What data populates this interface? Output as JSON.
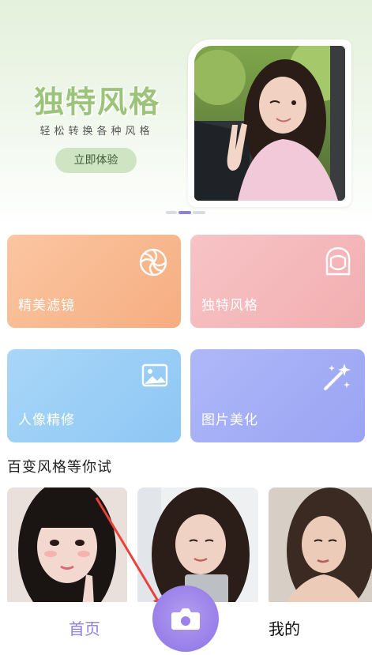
{
  "banner": {
    "title": "独特风格",
    "subtitle": "轻松转换各种风格",
    "button": "立即体验",
    "photo_icon": "woman-portrait-image",
    "carousel_active_index": 1,
    "carousel_count": 3
  },
  "features": [
    {
      "label": "精美滤镜",
      "icon": "flower-shutter-icon",
      "color": "#f8b68c"
    },
    {
      "label": "独特风格",
      "icon": "woman-face-icon",
      "color": "#f5b7b9"
    },
    {
      "label": "人像精修",
      "icon": "image-icon",
      "color": "#9ecff6"
    },
    {
      "label": "图片美化",
      "icon": "magic-wand-icon",
      "color": "#a8b0f6"
    }
  ],
  "styles_section": {
    "title": "百变风格等你试",
    "thumbnails": [
      "style-thumb-1",
      "style-thumb-2",
      "style-thumb-3"
    ]
  },
  "tabbar": {
    "home": "首页",
    "mine": "我的",
    "camera_icon": "camera-icon",
    "active_color": "#8f80e0"
  },
  "annotation": {
    "arrow_color": "#e8423a"
  }
}
